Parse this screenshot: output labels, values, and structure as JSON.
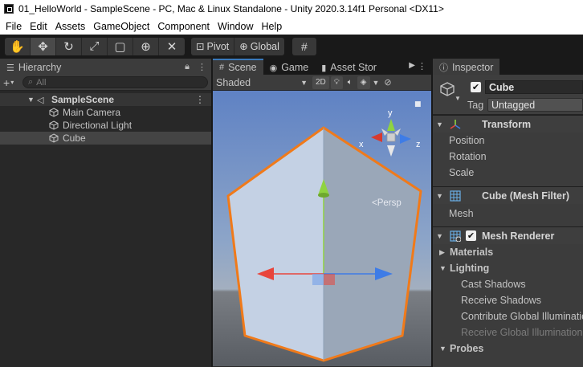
{
  "window": {
    "title": "01_HelloWorld - SampleScene - PC, Mac & Linux Standalone - Unity 2020.3.14f1 Personal <DX11>"
  },
  "menu": [
    "File",
    "Edit",
    "Assets",
    "GameObject",
    "Component",
    "Window",
    "Help"
  ],
  "toolbar": {
    "pivot_label": "Pivot",
    "global_label": "Global"
  },
  "hierarchy": {
    "tab_label": "Hierarchy",
    "search_placeholder": "All",
    "scene_name": "SampleScene",
    "objects": [
      "Main Camera",
      "Directional Light",
      "Cube"
    ],
    "selected": "Cube"
  },
  "scene": {
    "tabs": [
      "Scene",
      "Game",
      "Asset Stor"
    ],
    "shading_mode": "Shaded",
    "mode_2d": "2D",
    "persp_label": "Persp",
    "gizmo_axes": {
      "x": "x",
      "y": "y",
      "z": "z"
    },
    "colors": {
      "sky": "#6f8fc0",
      "ground": "#5b5f66",
      "selection_outline": "#f07a1a",
      "x_axis": "#e8453c",
      "y_axis": "#8fd340",
      "z_axis": "#3e7ce6"
    }
  },
  "inspector": {
    "tab_label": "Inspector",
    "object_name": "Cube",
    "tag_label": "Tag",
    "tag_value": "Untagged",
    "transform": {
      "title": "Transform",
      "props": [
        "Position",
        "Rotation",
        "Scale"
      ]
    },
    "mesh_filter": {
      "title": "Cube (Mesh Filter)",
      "props": [
        "Mesh"
      ]
    },
    "mesh_renderer": {
      "title": "Mesh Renderer",
      "sections": [
        "Materials",
        "Lighting"
      ],
      "lighting_items": [
        "Cast Shadows",
        "Receive Shadows",
        "Contribute Global Illumination"
      ],
      "disabled_item": "Receive Global Illumination",
      "last_section": "Probes"
    }
  }
}
